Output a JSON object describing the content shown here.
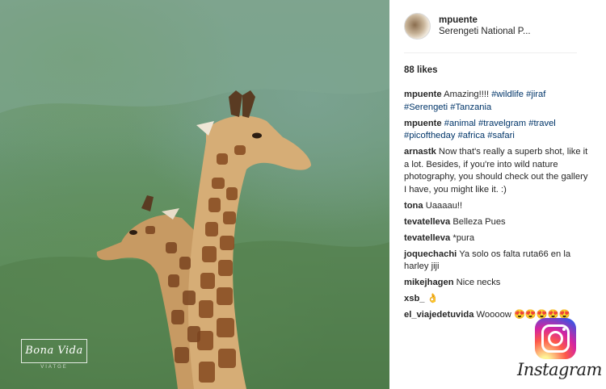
{
  "post": {
    "username": "mpuente",
    "location": "Serengeti National P...",
    "likes": "88 likes"
  },
  "comments": [
    {
      "user": "mpuente",
      "parts": [
        {
          "t": "Amazing!!!! ",
          "tag": false
        },
        {
          "t": "#wildlife",
          "tag": true
        },
        {
          "t": " ",
          "tag": false
        },
        {
          "t": "#jiraf",
          "tag": true
        },
        {
          "t": " ",
          "tag": false
        },
        {
          "t": "#Serengeti",
          "tag": true
        },
        {
          "t": " ",
          "tag": false
        },
        {
          "t": "#Tanzania",
          "tag": true
        }
      ]
    },
    {
      "user": "mpuente",
      "parts": [
        {
          "t": "#animal",
          "tag": true
        },
        {
          "t": " ",
          "tag": false
        },
        {
          "t": "#travelgram",
          "tag": true
        },
        {
          "t": " ",
          "tag": false
        },
        {
          "t": "#travel",
          "tag": true
        },
        {
          "t": " ",
          "tag": false
        },
        {
          "t": "#picoftheday",
          "tag": true
        },
        {
          "t": " ",
          "tag": false
        },
        {
          "t": "#africa",
          "tag": true
        },
        {
          "t": " ",
          "tag": false
        },
        {
          "t": "#safari",
          "tag": true
        }
      ]
    },
    {
      "user": "arnastk",
      "parts": [
        {
          "t": "Now that's really a superb shot, like it a lot. Besides, if you're into wild nature photography, you should check out the gallery I have, you might like it. :)",
          "tag": false
        }
      ]
    },
    {
      "user": "tona",
      "parts": [
        {
          "t": "Uaaaau!!",
          "tag": false
        }
      ]
    },
    {
      "user": "tevatelleva",
      "parts": [
        {
          "t": "Belleza Pues",
          "tag": false
        }
      ]
    },
    {
      "user": "tevatelleva",
      "parts": [
        {
          "t": "*pura",
          "tag": false
        }
      ]
    },
    {
      "user": "joquechachi",
      "parts": [
        {
          "t": "Ya solo os falta ruta66 en la harley jiji",
          "tag": false
        }
      ]
    },
    {
      "user": "mikejhagen",
      "parts": [
        {
          "t": "Nice necks",
          "tag": false
        }
      ]
    },
    {
      "user": "xsb_",
      "parts": [
        {
          "t": "👌",
          "tag": false
        }
      ]
    },
    {
      "user": "el_viajedetuvida",
      "parts": [
        {
          "t": "Woooow 😍😍😍😍😍",
          "tag": false
        }
      ]
    }
  ],
  "watermark": {
    "title": "Bona Vida",
    "subtitle": "VIATGE"
  },
  "brand": {
    "wordmark": "Instagram",
    "icon": "instagram-logo-icon",
    "tag_color": "#003569"
  }
}
